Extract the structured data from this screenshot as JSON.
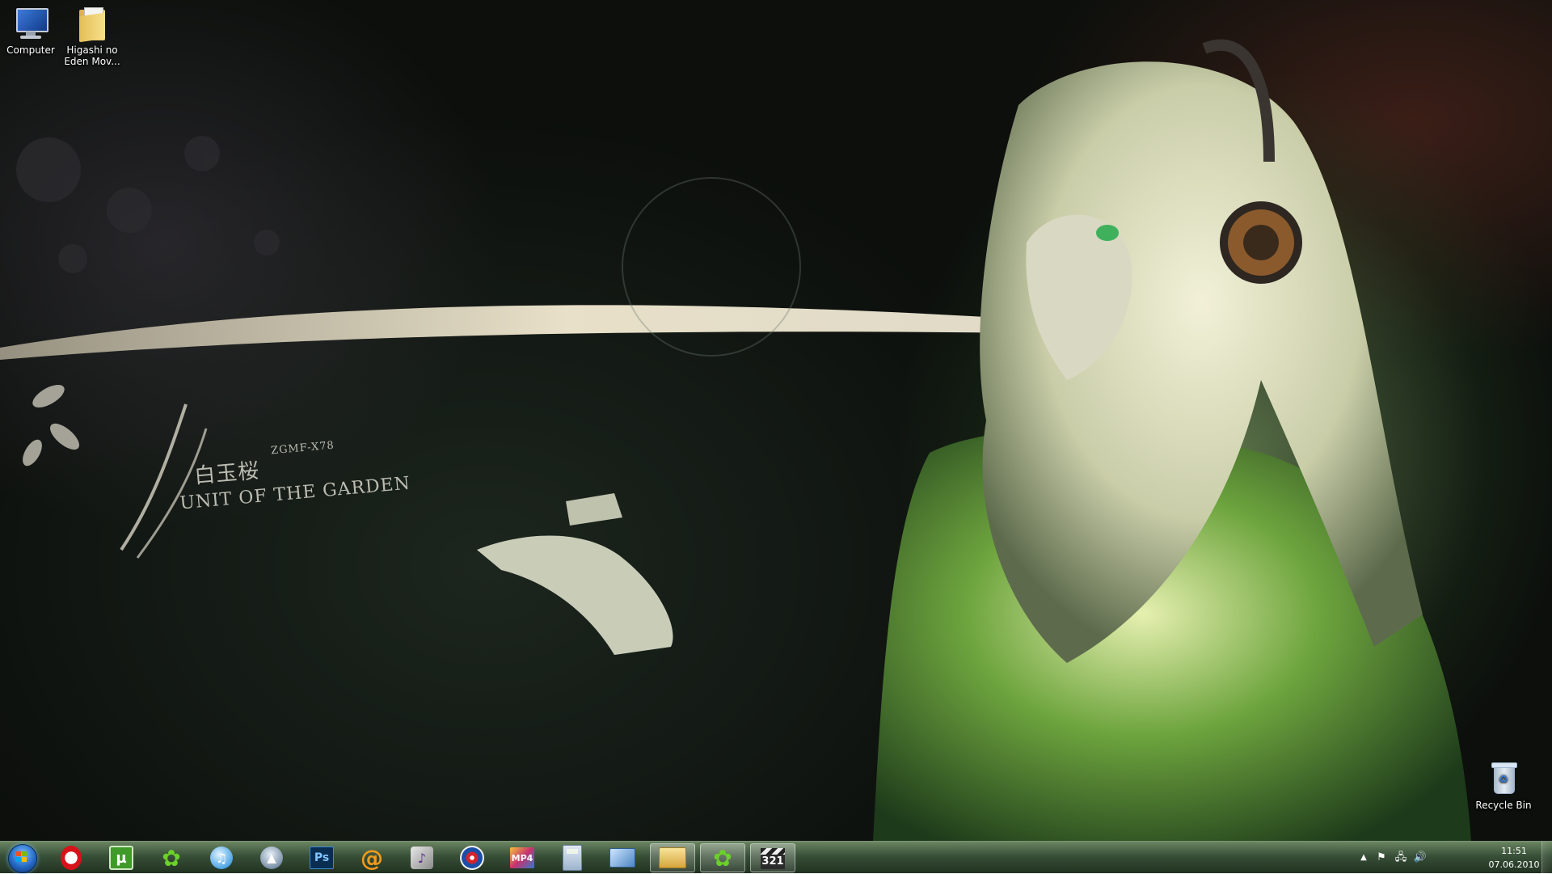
{
  "desktop_icons": [
    {
      "name": "computer",
      "label": "Computer"
    },
    {
      "name": "folder",
      "label": "Higashi no Eden Mov..."
    },
    {
      "name": "recycle-bin",
      "label": "Recycle Bin"
    }
  ],
  "wallpaper": {
    "title": "UNIT OF THE GARDEN",
    "code": "ZGMF-X78",
    "kanji": "白玉桜"
  },
  "taskbar": {
    "start_icon": "windows-logo-icon",
    "apps": [
      {
        "name": "opera",
        "icon": "opera-icon",
        "glyph": "",
        "open": false
      },
      {
        "name": "utorrent",
        "icon": "utorrent-icon",
        "glyph": "µ",
        "open": false
      },
      {
        "name": "icq",
        "icon": "icq-flower-icon",
        "glyph": "✿",
        "open": false
      },
      {
        "name": "itunes",
        "icon": "itunes-icon",
        "glyph": "♫",
        "open": false
      },
      {
        "name": "launcher",
        "icon": "launcher-icon",
        "glyph": "▲",
        "open": false
      },
      {
        "name": "photoshop",
        "icon": "photoshop-icon",
        "glyph": "Ps",
        "open": false
      },
      {
        "name": "mail-agent",
        "icon": "mail-at-icon",
        "glyph": "@",
        "open": false
      },
      {
        "name": "media-player",
        "icon": "media-player-icon",
        "glyph": "♪",
        "open": false
      },
      {
        "name": "disc-burner",
        "icon": "disc-icon",
        "glyph": "",
        "open": false
      },
      {
        "name": "mp4-converter",
        "icon": "mp4-icon",
        "glyph": "MP4",
        "open": false
      },
      {
        "name": "calculator",
        "icon": "calculator-icon",
        "glyph": "",
        "open": false
      },
      {
        "name": "network",
        "icon": "network-icon",
        "glyph": "",
        "open": false
      },
      {
        "name": "explorer",
        "icon": "folder-icon",
        "glyph": "",
        "open": true
      },
      {
        "name": "icq-open",
        "icon": "icq-flower-icon",
        "glyph": "✿",
        "open": true
      },
      {
        "name": "video-editor",
        "icon": "clapper-icon",
        "glyph": "321",
        "open": true
      }
    ]
  },
  "tray": {
    "show_hidden": "▲",
    "action_center": "⚑",
    "network": "🖧",
    "volume": "🔊",
    "time": "11:51",
    "date": "07.06.2010"
  },
  "colors": {
    "taskbar_tint": "#2d462d",
    "start_orb": "#2469c4"
  }
}
